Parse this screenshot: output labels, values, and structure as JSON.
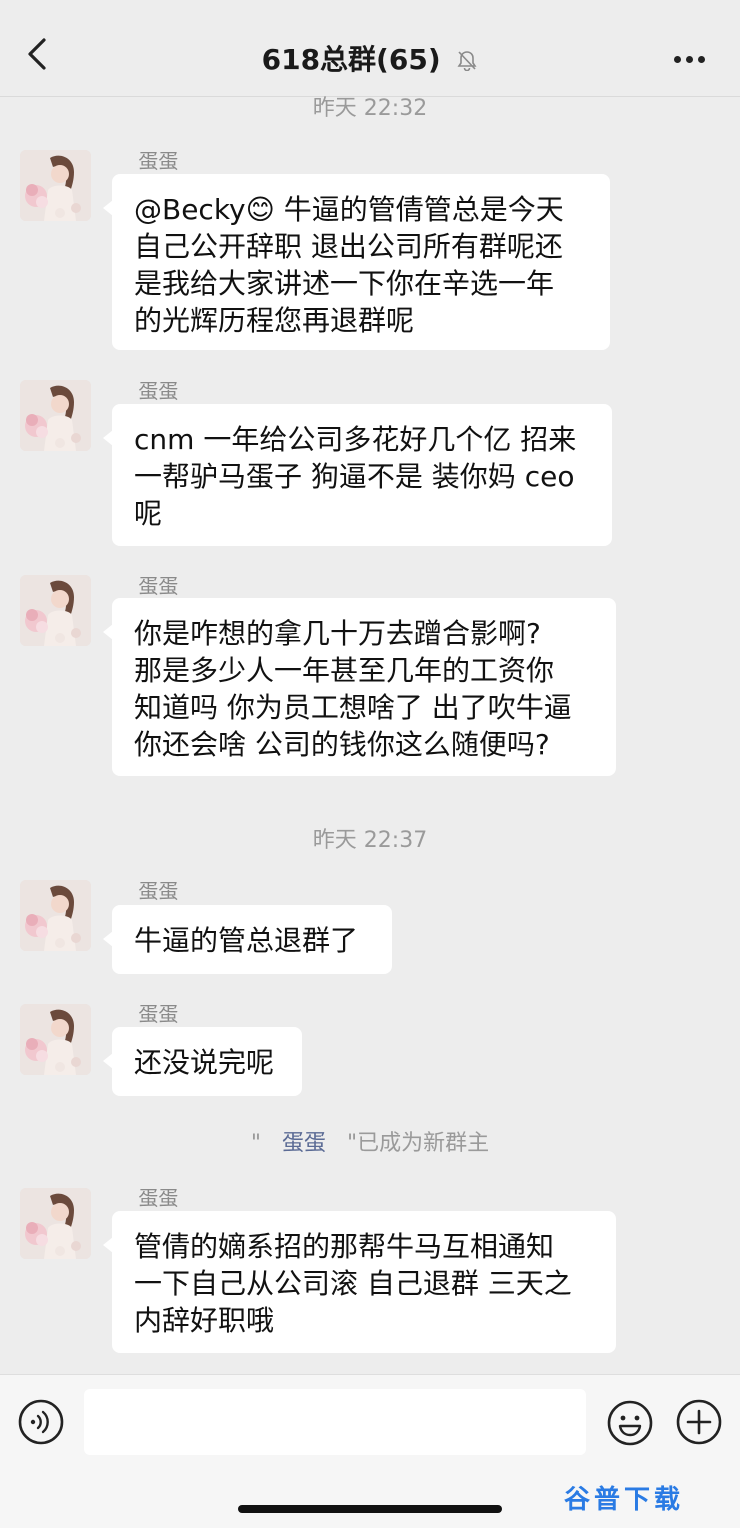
{
  "header": {
    "title": "618总群(65)"
  },
  "messages": [
    {
      "type": "time",
      "text": "昨天 22:32"
    },
    {
      "type": "msg",
      "sender": "蛋蛋",
      "lines": [
        "@Becky😊 牛逼的管倩管总是今天",
        "自己公开辞职 退出公司所有群呢还",
        "是我给大家讲述一下你在辛选一年",
        "的光辉历程您再退群呢"
      ]
    },
    {
      "type": "msg",
      "sender": "蛋蛋",
      "lines": [
        "cnm 一年给公司多花好几个亿 招来",
        "一帮驴马蛋子 狗逼不是 装你妈 ceo",
        "呢"
      ]
    },
    {
      "type": "msg",
      "sender": "蛋蛋",
      "lines": [
        "你是咋想的拿几十万去蹭合影啊?",
        "那是多少人一年甚至几年的工资你",
        "知道吗 你为员工想啥了 出了吹牛逼",
        "你还会啥 公司的钱你这么随便吗?"
      ]
    },
    {
      "type": "time",
      "text": "昨天 22:37"
    },
    {
      "type": "msg",
      "sender": "蛋蛋",
      "lines": [
        "牛逼的管总退群了"
      ]
    },
    {
      "type": "msg",
      "sender": "蛋蛋",
      "lines": [
        "还没说完呢"
      ]
    },
    {
      "type": "system",
      "prefix": "\"",
      "name": "蛋蛋",
      "suffix": "\"已成为新群主"
    },
    {
      "type": "msg",
      "sender": "蛋蛋",
      "lines": [
        "管倩的嫡系招的那帮牛马互相通知",
        "一下自己从公司滚 自己退群 三天之",
        "内辞好职哦"
      ]
    }
  ],
  "input": {
    "value": ""
  },
  "watermark": "谷普下载",
  "colors": {
    "background": "#ededed",
    "bubble": "#ffffff",
    "system_name": "#5b6b95",
    "watermark": "#2a7be4"
  },
  "icons": [
    "back-arrow-icon",
    "mute-bell-icon",
    "more-dots-icon",
    "voice-icon",
    "emoji-icon",
    "plus-icon"
  ]
}
